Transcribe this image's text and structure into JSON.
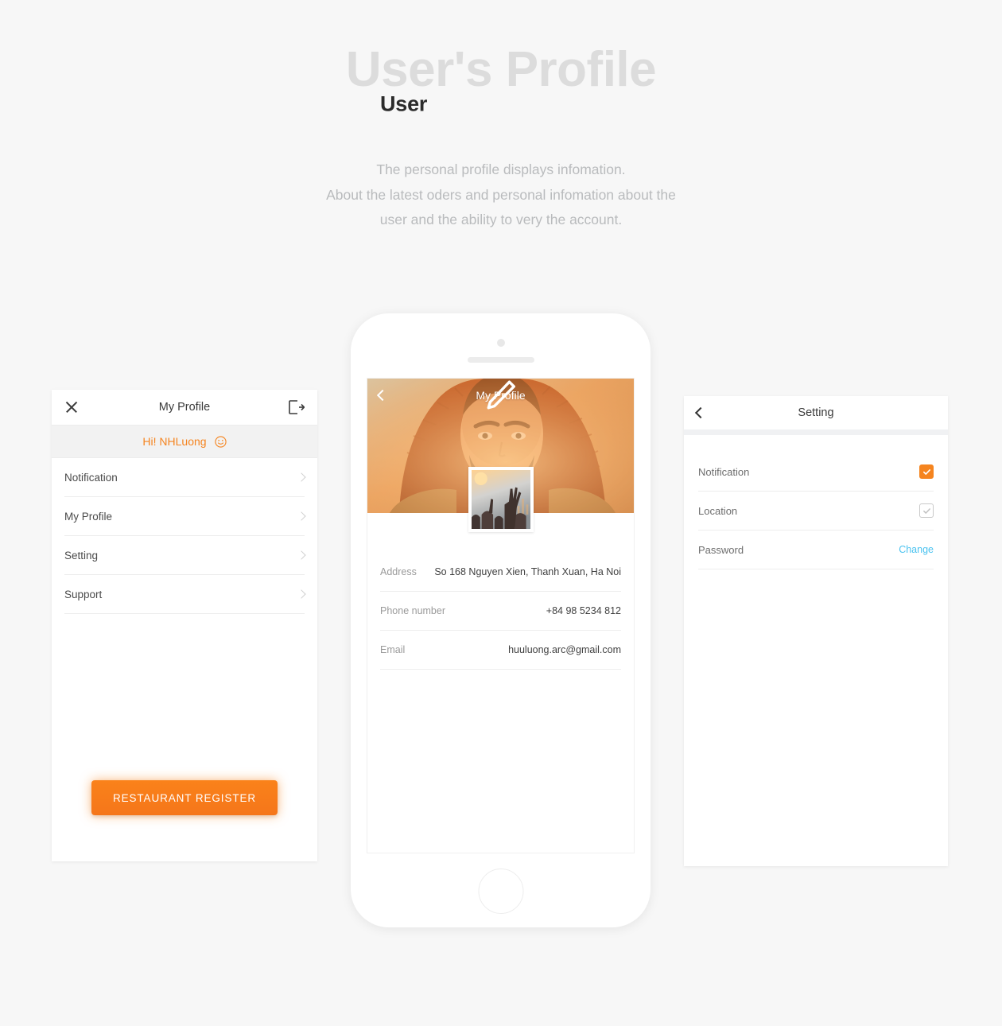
{
  "hero": {
    "title_large": "User's Profile",
    "title_small": "User",
    "subtitle_line1": "The personal profile displays infomation.",
    "subtitle_line2": "About the latest oders and personal infomation about the",
    "subtitle_line3": "user and the ability to very the account."
  },
  "colors": {
    "accent_orange": "#f5841f",
    "link_blue": "#4cc3f0",
    "page_background": "#f7f7f7",
    "title_gray": "#dcdcdc",
    "subtitle_gray": "#b9bbbd"
  },
  "left_screen": {
    "header": {
      "close_icon": "close-icon",
      "title": "My Profile",
      "logout_icon": "logout-icon"
    },
    "greeting": {
      "text": "Hi! NHLuong",
      "emoji_icon": "smiley-icon"
    },
    "menu": [
      {
        "label": "Notification",
        "chevron": "chevron-right-icon"
      },
      {
        "label": "My Profile",
        "chevron": "chevron-right-icon"
      },
      {
        "label": "Setting",
        "chevron": "chevron-right-icon"
      },
      {
        "label": "Support",
        "chevron": "chevron-right-icon"
      }
    ],
    "register_button": "RESTAURANT REGISTER"
  },
  "center_screen": {
    "header": {
      "back_icon": "chevron-left-icon",
      "title": "My Profile",
      "edit_icon": "pencil-icon"
    },
    "avatar_icon": "avatar-thumbnail",
    "info": [
      {
        "label": "Address",
        "value": "So 168 Nguyen Xien, Thanh Xuan, Ha Noi"
      },
      {
        "label": "Phone number",
        "value": "+84 98 5234 812"
      },
      {
        "label": "Email",
        "value": "huuluong.arc@gmail.com"
      }
    ]
  },
  "right_screen": {
    "header": {
      "back_icon": "chevron-left-icon",
      "title": "Setting"
    },
    "rows": [
      {
        "label": "Notification",
        "control": "checkbox",
        "checked": true
      },
      {
        "label": "Location",
        "control": "checkbox",
        "checked": false
      },
      {
        "label": "Password",
        "control": "link",
        "link_label": "Change"
      }
    ]
  }
}
